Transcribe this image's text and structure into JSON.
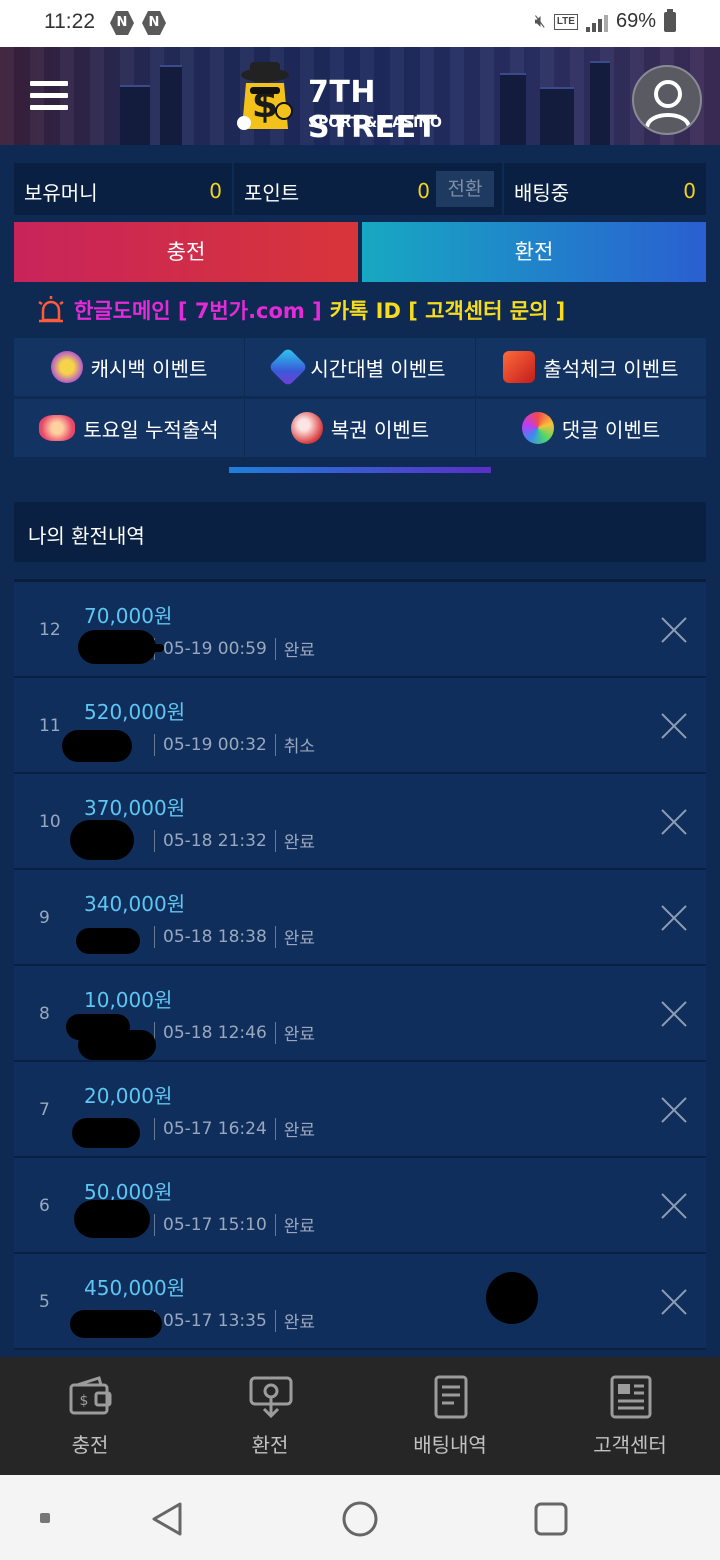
{
  "status_bar": {
    "time": "11:22",
    "badge_1": "N",
    "badge_2": "N",
    "lte": "LTE",
    "battery": "69%"
  },
  "header": {
    "brand_title": "7TH STREET",
    "brand_sub": "SPORT & CASINO"
  },
  "balances": {
    "money_label": "보유머니",
    "money_value": "0",
    "point_label": "포인트",
    "point_value": "0",
    "convert_label": "전환",
    "betting_label": "배팅중",
    "betting_value": "0"
  },
  "actions": {
    "deposit": "충전",
    "withdraw": "환전"
  },
  "notice": {
    "part1": "한글도메인 [ 7번가.com ]",
    "part2": "카톡 ID [ 고객센터 문의 ]"
  },
  "events": [
    {
      "label": "캐시백 이벤트",
      "icon": "cashback-coin-icon"
    },
    {
      "label": "시간대별 이벤트",
      "icon": "gem-icon"
    },
    {
      "label": "출석체크 이벤트",
      "icon": "dice-icon"
    },
    {
      "label": "토요일 누적출석",
      "icon": "chip-icon"
    },
    {
      "label": "복권 이벤트",
      "icon": "lottery-ball-icon"
    },
    {
      "label": "댓글 이벤트",
      "icon": "comment-wheel-icon"
    }
  ],
  "history": {
    "title": "나의 환전내역",
    "rows": [
      {
        "num": "12",
        "amount": "70,000원",
        "datetime": "05-19 00:59",
        "status": "완료"
      },
      {
        "num": "11",
        "amount": "520,000원",
        "datetime": "05-19 00:32",
        "status": "취소"
      },
      {
        "num": "10",
        "amount": "370,000원",
        "datetime": "05-18 21:32",
        "status": "완료"
      },
      {
        "num": "9",
        "amount": "340,000원",
        "datetime": "05-18 18:38",
        "status": "완료"
      },
      {
        "num": "8",
        "amount": "10,000원",
        "datetime": "05-18 12:46",
        "status": "완료"
      },
      {
        "num": "7",
        "amount": "20,000원",
        "datetime": "05-17 16:24",
        "status": "완료"
      },
      {
        "num": "6",
        "amount": "50,000원",
        "datetime": "05-17 15:10",
        "status": "완료"
      },
      {
        "num": "5",
        "amount": "450,000원",
        "datetime": "05-17 13:35",
        "status": "완료"
      }
    ]
  },
  "bottom_nav": [
    {
      "label": "충전",
      "icon": "wallet-icon"
    },
    {
      "label": "환전",
      "icon": "withdraw-atm-icon"
    },
    {
      "label": "배팅내역",
      "icon": "document-icon"
    },
    {
      "label": "고객센터",
      "icon": "newspaper-icon"
    }
  ],
  "colors": {
    "page_bg": "#0f2a52",
    "accent_amount": "#5ec6f1",
    "value_yellow": "#f5d21a",
    "notice_pink": "#e52bd8"
  }
}
